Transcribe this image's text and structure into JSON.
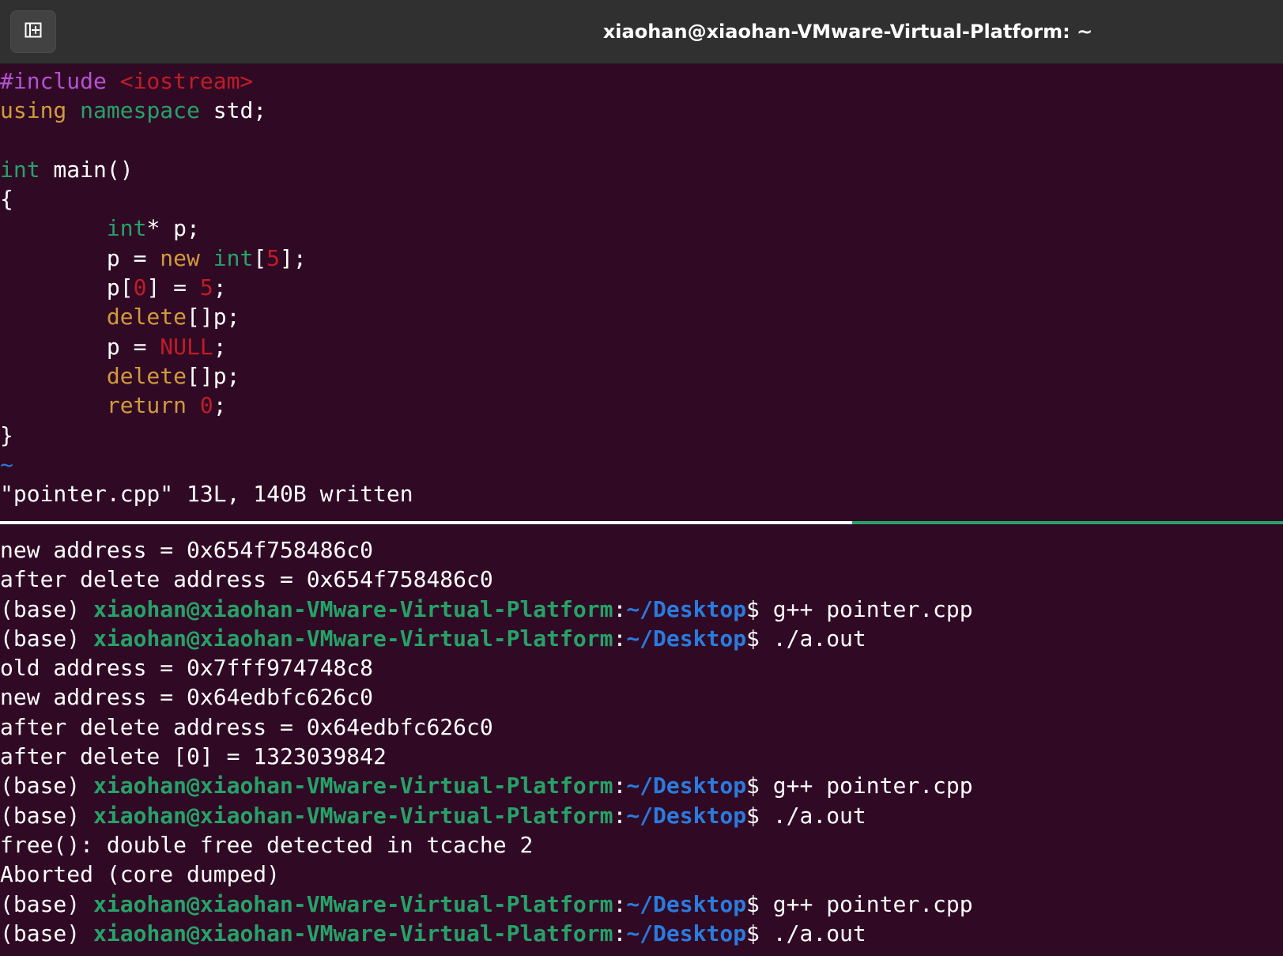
{
  "window": {
    "title": "xiaohan@xiaohan-VMware-Virtual-Platform: ~"
  },
  "editor": {
    "lines": [
      [
        {
          "t": "#include",
          "c": "pre"
        },
        {
          "t": " ",
          "c": ""
        },
        {
          "t": "<iostream>",
          "c": "inc"
        }
      ],
      [
        {
          "t": "using",
          "c": "kw"
        },
        {
          "t": " ",
          "c": ""
        },
        {
          "t": "namespace",
          "c": "ty"
        },
        {
          "t": " std;",
          "c": ""
        }
      ],
      [],
      [
        {
          "t": "int",
          "c": "ty"
        },
        {
          "t": " main()",
          "c": ""
        }
      ],
      [
        {
          "t": "{",
          "c": ""
        }
      ],
      [
        {
          "t": "        ",
          "c": ""
        },
        {
          "t": "int",
          "c": "ty"
        },
        {
          "t": "* p;",
          "c": ""
        }
      ],
      [
        {
          "t": "        p = ",
          "c": ""
        },
        {
          "t": "new",
          "c": "kw"
        },
        {
          "t": " ",
          "c": ""
        },
        {
          "t": "int",
          "c": "ty"
        },
        {
          "t": "[",
          "c": ""
        },
        {
          "t": "5",
          "c": "num"
        },
        {
          "t": "];",
          "c": ""
        }
      ],
      [
        {
          "t": "        p[",
          "c": ""
        },
        {
          "t": "0",
          "c": "num"
        },
        {
          "t": "] = ",
          "c": ""
        },
        {
          "t": "5",
          "c": "num"
        },
        {
          "t": ";",
          "c": ""
        }
      ],
      [
        {
          "t": "        ",
          "c": ""
        },
        {
          "t": "delete",
          "c": "kw"
        },
        {
          "t": "[]p;",
          "c": ""
        }
      ],
      [
        {
          "t": "        p = ",
          "c": ""
        },
        {
          "t": "NULL",
          "c": "num"
        },
        {
          "t": ";",
          "c": ""
        }
      ],
      [
        {
          "t": "        ",
          "c": ""
        },
        {
          "t": "delete",
          "c": "kw"
        },
        {
          "t": "[]p;",
          "c": ""
        }
      ],
      [
        {
          "t": "        ",
          "c": ""
        },
        {
          "t": "return",
          "c": "kw"
        },
        {
          "t": " ",
          "c": ""
        },
        {
          "t": "0",
          "c": "num"
        },
        {
          "t": ";",
          "c": ""
        }
      ],
      [
        {
          "t": "}",
          "c": ""
        }
      ],
      [
        {
          "t": "~",
          "c": "tilde"
        }
      ]
    ],
    "status": "\"pointer.cpp\" 13L, 140B written"
  },
  "terminal": {
    "lines": [
      [
        {
          "t": "new address = 0x654f758486c0",
          "c": ""
        }
      ],
      [
        {
          "t": "after delete address = 0x654f758486c0",
          "c": ""
        }
      ],
      [
        {
          "t": "(base) ",
          "c": ""
        },
        {
          "t": "xiaohan@xiaohan-VMware-Virtual-Platform",
          "c": "user"
        },
        {
          "t": ":",
          "c": ""
        },
        {
          "t": "~/Desktop",
          "c": "path"
        },
        {
          "t": "$ g++ pointer.cpp",
          "c": ""
        }
      ],
      [
        {
          "t": "(base) ",
          "c": ""
        },
        {
          "t": "xiaohan@xiaohan-VMware-Virtual-Platform",
          "c": "user"
        },
        {
          "t": ":",
          "c": ""
        },
        {
          "t": "~/Desktop",
          "c": "path"
        },
        {
          "t": "$ ./a.out",
          "c": ""
        }
      ],
      [
        {
          "t": "old address = 0x7fff974748c8",
          "c": ""
        }
      ],
      [
        {
          "t": "new address = 0x64edbfc626c0",
          "c": ""
        }
      ],
      [
        {
          "t": "after delete address = 0x64edbfc626c0",
          "c": ""
        }
      ],
      [
        {
          "t": "after delete [0] = 1323039842",
          "c": ""
        }
      ],
      [
        {
          "t": "(base) ",
          "c": ""
        },
        {
          "t": "xiaohan@xiaohan-VMware-Virtual-Platform",
          "c": "user"
        },
        {
          "t": ":",
          "c": ""
        },
        {
          "t": "~/Desktop",
          "c": "path"
        },
        {
          "t": "$ g++ pointer.cpp",
          "c": ""
        }
      ],
      [
        {
          "t": "(base) ",
          "c": ""
        },
        {
          "t": "xiaohan@xiaohan-VMware-Virtual-Platform",
          "c": "user"
        },
        {
          "t": ":",
          "c": ""
        },
        {
          "t": "~/Desktop",
          "c": "path"
        },
        {
          "t": "$ ./a.out",
          "c": ""
        }
      ],
      [
        {
          "t": "free(): double free detected in tcache 2",
          "c": ""
        }
      ],
      [
        {
          "t": "Aborted (core dumped)",
          "c": ""
        }
      ],
      [
        {
          "t": "(base) ",
          "c": ""
        },
        {
          "t": "xiaohan@xiaohan-VMware-Virtual-Platform",
          "c": "user"
        },
        {
          "t": ":",
          "c": ""
        },
        {
          "t": "~/Desktop",
          "c": "path"
        },
        {
          "t": "$ g++ pointer.cpp",
          "c": ""
        }
      ],
      [
        {
          "t": "(base) ",
          "c": ""
        },
        {
          "t": "xiaohan@xiaohan-VMware-Virtual-Platform",
          "c": "user"
        },
        {
          "t": ":",
          "c": ""
        },
        {
          "t": "~/Desktop",
          "c": "path"
        },
        {
          "t": "$ ./a.out",
          "c": ""
        }
      ]
    ]
  },
  "icons": {
    "new_tab": "new-tab-icon"
  },
  "colors": {
    "background": "#300a24",
    "titlebar": "#303030",
    "prompt_user": "#26a269",
    "prompt_path": "#2a7bde",
    "divider_active": "#26a269"
  }
}
